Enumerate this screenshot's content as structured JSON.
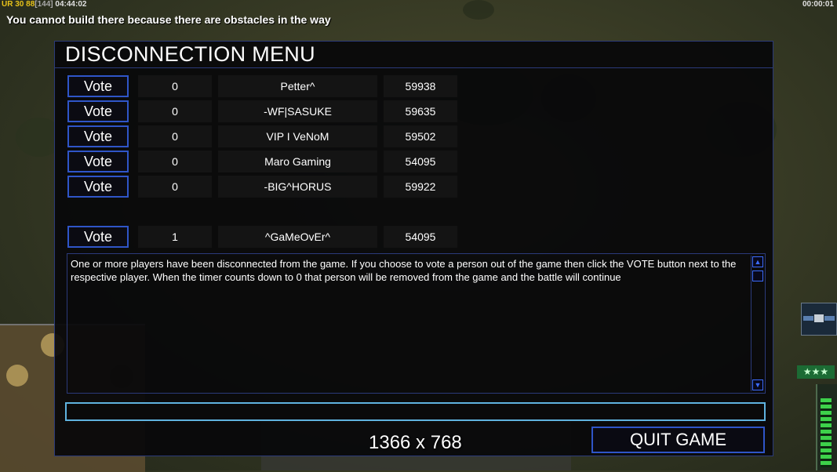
{
  "hud": {
    "top_left_1": "UR",
    "top_left_2": "30",
    "top_left_3": "88",
    "top_left_4": "[144]",
    "top_left_5": "04:44:02",
    "top_right": "00:00:01",
    "message": "You cannot build there because there are obstacles in the way"
  },
  "dialog": {
    "title": "DISCONNECTION MENU",
    "players": [
      {
        "vote_label": "Vote",
        "votes": "0",
        "name": "Petter^",
        "ping": "59938"
      },
      {
        "vote_label": "Vote",
        "votes": "0",
        "name": "-WF|SASUKE",
        "ping": "59635"
      },
      {
        "vote_label": "Vote",
        "votes": "0",
        "name": "VIP I VeNoM",
        "ping": "59502"
      },
      {
        "vote_label": "Vote",
        "votes": "0",
        "name": "Maro Gaming",
        "ping": "54095"
      },
      {
        "vote_label": "Vote",
        "votes": "0",
        "name": "-BIG^HORUS",
        "ping": "59922"
      }
    ],
    "local_player": {
      "vote_label": "Vote",
      "votes": "1",
      "name": "^GaMeOvEr^",
      "ping": "54095"
    },
    "info_text": "One or more players have been disconnected from the game. If you choose to vote a person out of the game then click the VOTE button next to the respective player. When the timer counts down to 0 that person will be removed from the game and the battle will continue",
    "chat_value": "",
    "quit_label": "QUIT GAME"
  },
  "overlay": {
    "resolution_label": "1366 x 768"
  },
  "icons": {
    "scroll_up": "arrow-up-icon",
    "scroll_down": "arrow-down-icon"
  }
}
